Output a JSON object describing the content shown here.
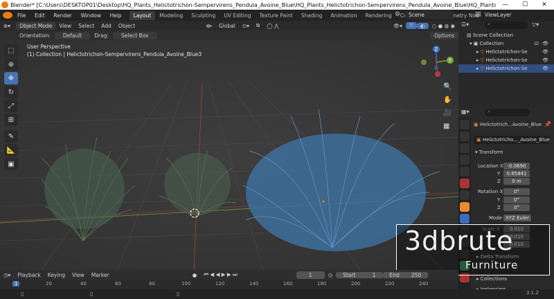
{
  "window": {
    "title": "Blender* [C:\\Users\\DESKTOP01\\Desktop\\HQ_Plants_Helictotrichon-Sempervirens_Pendula_Avoine_Blue\\HQ_Plants_Helictotrichon-Sempervirens_Pendula_Avoine_Blue\\HQ_Plants_Helictotrichon-Sempervirens_Pendula_Avoine_...",
    "minimize": "—",
    "maximize": "☐",
    "close": "✕"
  },
  "menu": [
    "File",
    "Edit",
    "Render",
    "Window",
    "Help"
  ],
  "workspaces": [
    {
      "label": "Layout",
      "active": true
    },
    {
      "label": "Modeling"
    },
    {
      "label": "Sculpting"
    },
    {
      "label": "UV Editing"
    },
    {
      "label": "Texture Paint"
    },
    {
      "label": "Shading"
    },
    {
      "label": "Animation"
    },
    {
      "label": "Rendering"
    },
    {
      "label": "Compositing"
    },
    {
      "label": "Geometry Nod"
    }
  ],
  "scene": "Scene",
  "view_layer": "ViewLayer",
  "viewport_header": {
    "mode": "Object Mode",
    "menus": [
      "View",
      "Select",
      "Add",
      "Object"
    ],
    "transform_orientation": "Global",
    "options": "Options"
  },
  "tool_options": {
    "orientation_label": "Orientation:",
    "orientation_value": "Default",
    "drag_label": "Drag:",
    "drag_value": "Select Box"
  },
  "viewport_info": {
    "line1": "User Perspective",
    "line2": "(1) Collection | Helictotrichon-Sempervirens_Pendula_Avoine_Blue3"
  },
  "gizmo": {
    "x": "X",
    "y": "Y",
    "z": "Z"
  },
  "outliner": {
    "scene_collection": "Scene Collection",
    "collection": "Collection",
    "items": [
      "Helictotrichon-Se",
      "Helictotrichon-Se",
      "Helictotrichon-Se"
    ]
  },
  "properties": {
    "object_name": "Helictotrich...Avoine_Blue",
    "data_name": "Helictotricho..._Avoine_Blue3",
    "transform_header": "Transform",
    "location_label": "Location X",
    "location": [
      "-0.0690",
      "0.85841",
      "0 m"
    ],
    "rotation_label": "Rotation X",
    "rotation": [
      "0°",
      "0°",
      "0°"
    ],
    "axis_y": "Y",
    "axis_z": "Z",
    "mode_label": "Mode",
    "mode_value": "XYZ Euler",
    "scale_label": "Scale X",
    "scale": [
      "0.010",
      "0.010",
      "0.010"
    ],
    "delta_transform": "Delta Transform",
    "collections": "Collections",
    "instancing": "Instancing"
  },
  "timeline": {
    "menus": [
      "Playback",
      "Keying",
      "View",
      "Marker"
    ],
    "current_frame": "1",
    "start_label": "Start",
    "start_value": "1",
    "end_label": "End",
    "end_value": "250",
    "ticks": [
      "1",
      "20",
      "40",
      "60",
      "80",
      "100",
      "120",
      "140",
      "160",
      "180",
      "200",
      "220",
      "240"
    ]
  },
  "version": "3.1.2",
  "watermark": {
    "line1": "3dbrute",
    "line2": "Furniture"
  },
  "colors": {
    "accent": "#4772b3",
    "bg": "#393939",
    "x_axis": "#c0394b",
    "y_axis": "#7ea83b",
    "z_axis": "#3f72c5"
  }
}
